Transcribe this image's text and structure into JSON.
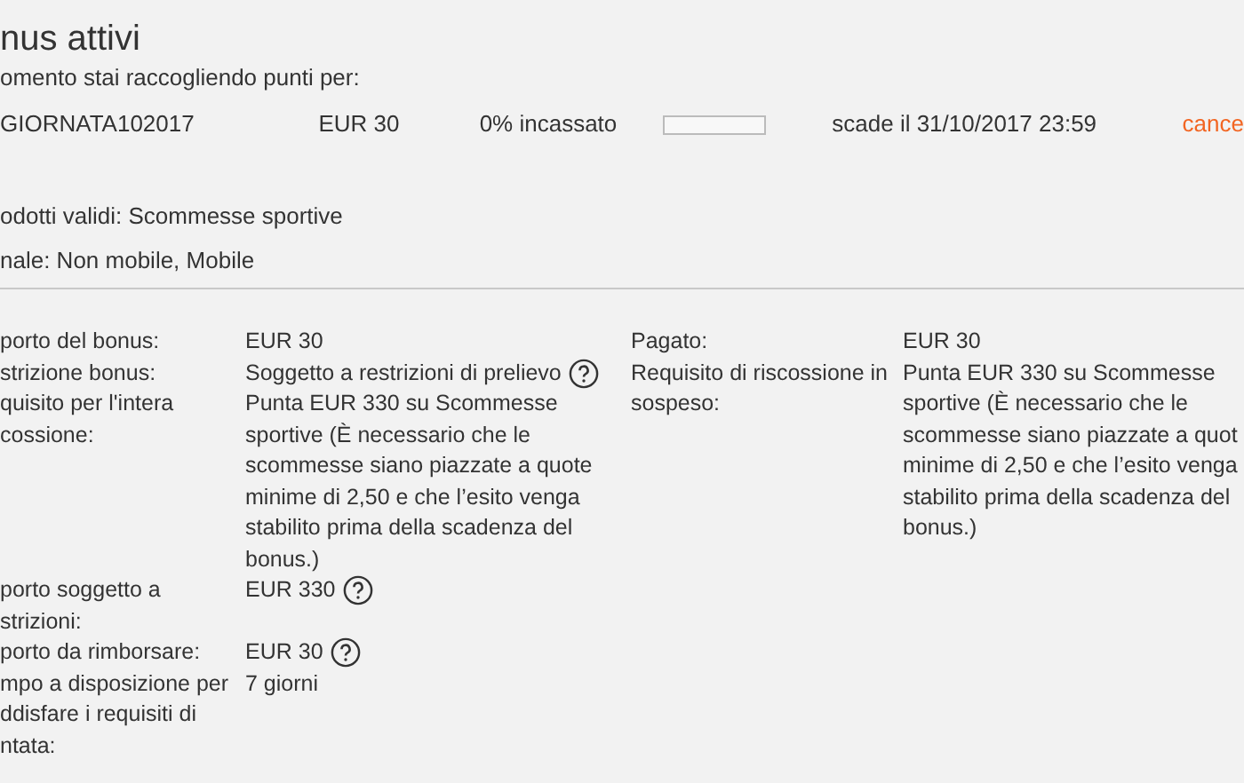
{
  "title": "nus attivi",
  "subtitle": "omento stai raccogliendo punti per:",
  "bonus": {
    "code": "GIORNATA102017",
    "amount": "EUR 30",
    "collected": "0% incassato",
    "level": 0,
    "expiry": "scade il 31/10/2017 23:59",
    "cancel": "cance"
  },
  "info": [
    "odotti validi: Scommesse sportive",
    "nale: Non mobile, Mobile"
  ],
  "details_left": [
    {
      "label": [
        "porto del bonus:"
      ],
      "value": [
        "EUR 30"
      ],
      "help": false
    },
    {
      "label": [
        "strizione bonus:"
      ],
      "value": [
        "Soggetto a restrizioni di prelievo"
      ],
      "help": true
    },
    {
      "label": [
        "quisito per l'intera",
        "cossione:"
      ],
      "value": [
        "Punta EUR 330 su Scommesse",
        "sportive (È necessario che le",
        "scommesse siano piazzate a quote",
        "minime di 2,50 e che l’esito venga",
        "stabilito prima della scadenza del",
        "bonus.)"
      ],
      "help": false
    },
    {
      "label": [
        "porto soggetto a",
        "strizioni:"
      ],
      "value": [
        "EUR 330"
      ],
      "help": true
    },
    {
      "label": [
        "porto da rimborsare:"
      ],
      "value": [
        "EUR 30"
      ],
      "help": true
    },
    {
      "label": [
        "mpo a disposizione per",
        "ddisfare i requisiti di",
        "ntata:"
      ],
      "value": [
        "7 giorni"
      ],
      "help": false
    }
  ],
  "details_right": [
    {
      "label": [
        "Pagato:"
      ],
      "value": [
        "EUR 30"
      ]
    },
    {
      "label": [
        "Requisito di riscossione in",
        "sospeso:"
      ],
      "value": [
        "Punta EUR 330 su Scommesse",
        "sportive (È necessario che le",
        "scommesse siano piazzate a quot",
        "minime di 2,50 e che l’esito venga",
        "stabilito prima della scadenza del",
        "bonus.)"
      ]
    }
  ]
}
